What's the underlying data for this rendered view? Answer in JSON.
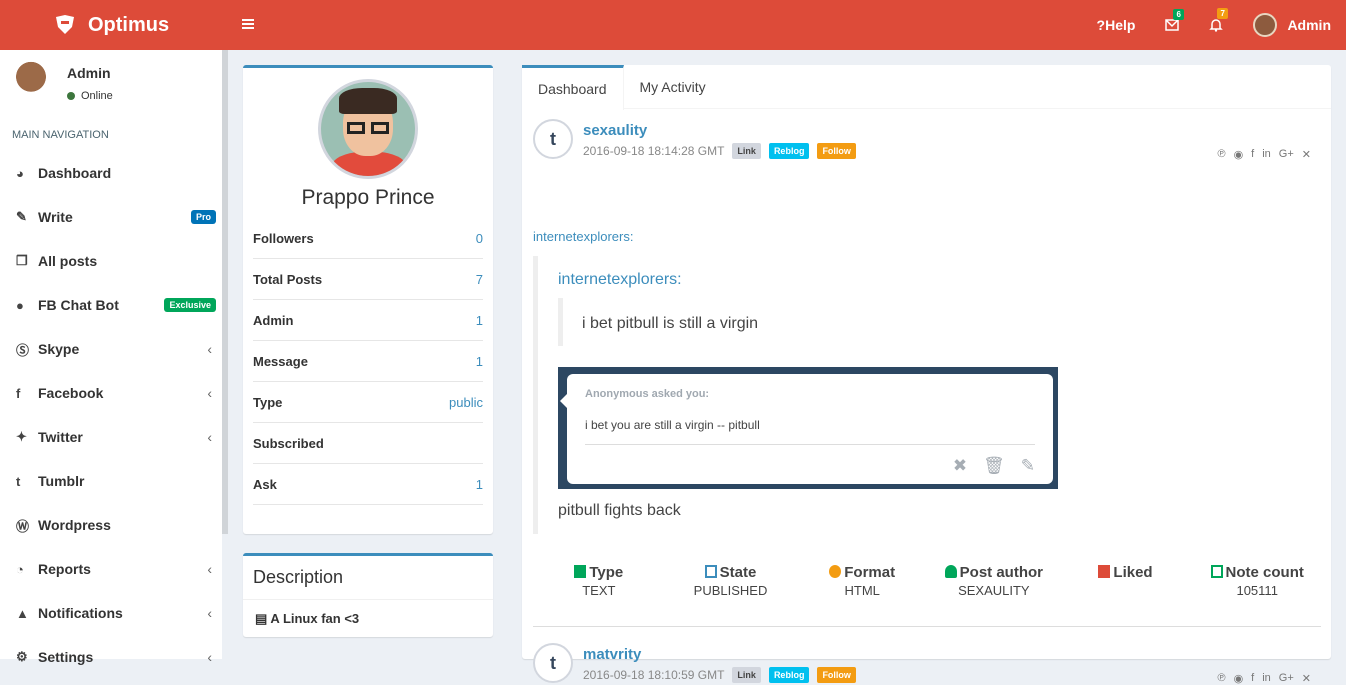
{
  "brand": {
    "name": "Optimus"
  },
  "topnav": {
    "help": "Help",
    "mail_badge": "6",
    "bell_badge": "7",
    "user": "Admin"
  },
  "sidebar": {
    "user": "Admin",
    "status": "Online",
    "header": "MAIN NAVIGATION",
    "items": [
      {
        "label": "Dashboard",
        "icon": "dashboard-icon"
      },
      {
        "label": "Write",
        "badge": "Pro"
      },
      {
        "label": "All posts"
      },
      {
        "label": "FB Chat Bot",
        "badge": "Exclusive"
      },
      {
        "label": "Skype"
      },
      {
        "label": "Facebook"
      },
      {
        "label": "Twitter"
      },
      {
        "label": "Tumblr"
      },
      {
        "label": "Wordpress"
      },
      {
        "label": "Reports"
      },
      {
        "label": "Notifications"
      },
      {
        "label": "Settings"
      }
    ]
  },
  "profile": {
    "name": "Prappo Prince",
    "rows": [
      {
        "k": "Followers",
        "v": "0"
      },
      {
        "k": "Total Posts",
        "v": "7"
      },
      {
        "k": "Admin",
        "v": "1"
      },
      {
        "k": "Message",
        "v": "1"
      },
      {
        "k": "Type",
        "v": "public"
      },
      {
        "k": "Subscribed",
        "v": ""
      },
      {
        "k": "Ask",
        "v": "1"
      }
    ]
  },
  "description": {
    "title": "Description",
    "text": "A Linux fan <3"
  },
  "tabs": [
    "Dashboard",
    "My Activity"
  ],
  "posts": [
    {
      "user": "sexaulity",
      "date": "2016-09-18 18:14:28 GMT",
      "tags": [
        "Link",
        "Reblog",
        "Follow"
      ],
      "source": "internetexplorers:",
      "quote_title": "internetexplorers:",
      "quote_text": "i bet pitbull is still a virgin",
      "ask_title": "Anonymous asked you:",
      "ask_text": "i bet you are still a virgin -- pitbull",
      "footer_text": "pitbull fights back",
      "stats": [
        {
          "h": "Type",
          "v": "TEXT",
          "c": "#00a65a"
        },
        {
          "h": "State",
          "v": "PUBLISHED",
          "c": "#3c8dbc"
        },
        {
          "h": "Format",
          "v": "HTML",
          "c": "#f39c12"
        },
        {
          "h": "Post author",
          "v": "SEXAULITY",
          "c": "#00a65a"
        },
        {
          "h": "Liked",
          "v": "",
          "c": "#dd4b39"
        },
        {
          "h": "Note count",
          "v": "105111",
          "c": "#00a65a"
        }
      ]
    },
    {
      "user": "matvrity",
      "date": "2016-09-18 18:10:59 GMT",
      "tags": [
        "Link",
        "Reblog",
        "Follow"
      ]
    }
  ]
}
